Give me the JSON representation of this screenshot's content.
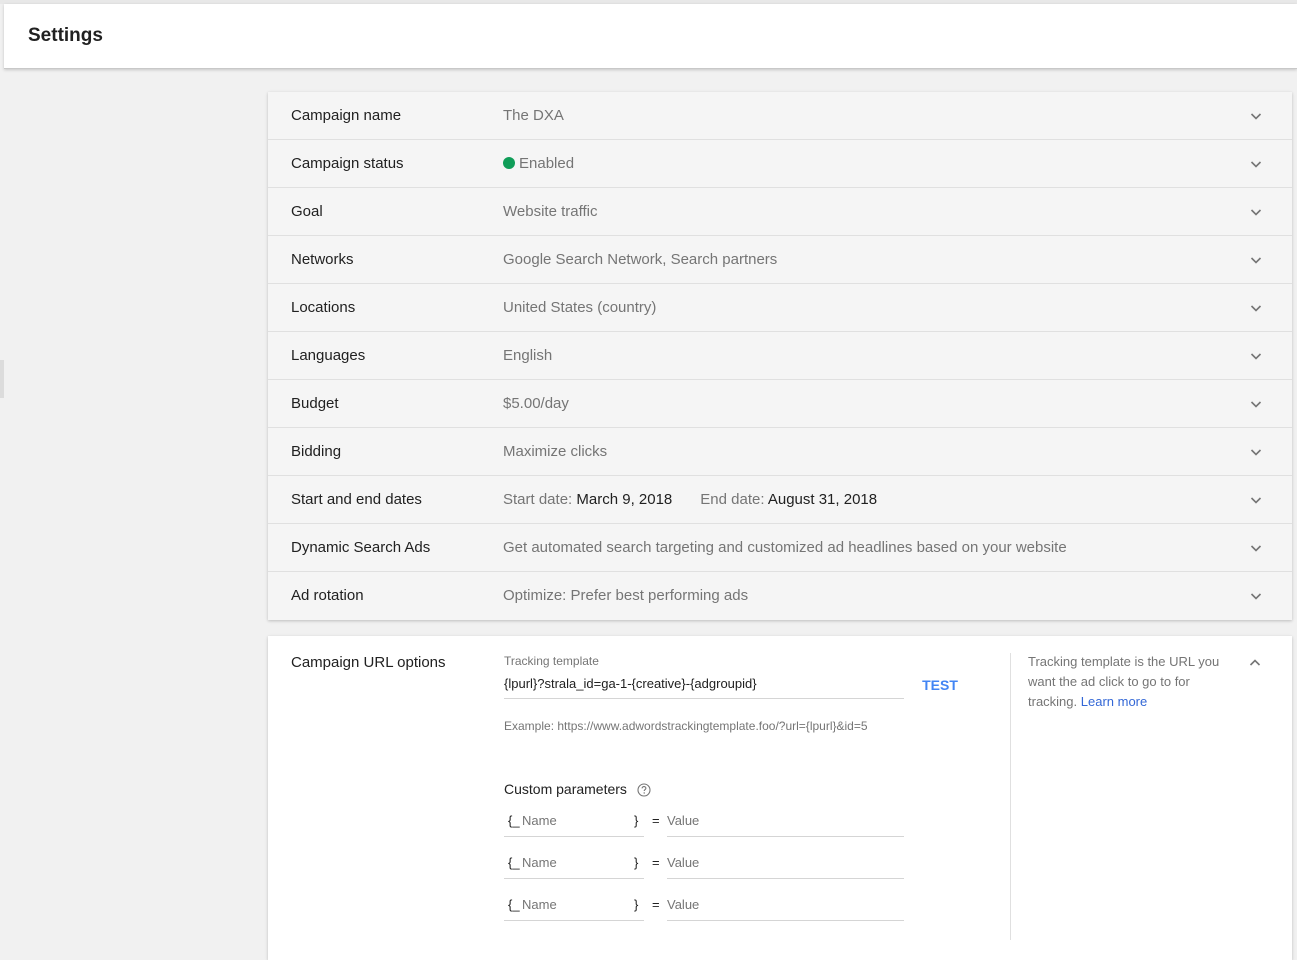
{
  "header": {
    "title": "Settings"
  },
  "settings": [
    {
      "label": "Campaign name",
      "value": "The DXA"
    },
    {
      "label": "Campaign status",
      "value": "Enabled",
      "status_color": "#0f9d58"
    },
    {
      "label": "Goal",
      "value": "Website traffic"
    },
    {
      "label": "Networks",
      "value": "Google Search Network, Search partners"
    },
    {
      "label": "Locations",
      "value": "United States (country)"
    },
    {
      "label": "Languages",
      "value": "English"
    },
    {
      "label": "Budget",
      "value": "$5.00/day"
    },
    {
      "label": "Bidding",
      "value": "Maximize clicks"
    },
    {
      "label": "Start and end dates",
      "start_label": "Start date:",
      "start_value": "March 9, 2018",
      "end_label": "End date:",
      "end_value": "August 31, 2018"
    },
    {
      "label": "Dynamic Search Ads",
      "value": "Get automated search targeting and customized ad headlines based on your website"
    },
    {
      "label": "Ad rotation",
      "value": "Optimize: Prefer best performing ads"
    }
  ],
  "url_options": {
    "label": "Campaign URL options",
    "tracking_caption": "Tracking template",
    "tracking_value": "{lpurl}?strala_id=ga-1-{creative}-{adgroupid}",
    "test_label": "TEST",
    "example": "Example: https://www.adwordstrackingtemplate.foo/?url={lpurl}&id=5",
    "custom_params_title": "Custom parameters",
    "params": [
      {
        "open": "{_",
        "name_placeholder": "Name",
        "close": "}",
        "eq": "=",
        "value_placeholder": "Value"
      },
      {
        "open": "{_",
        "name_placeholder": "Name",
        "close": "}",
        "eq": "=",
        "value_placeholder": "Value"
      },
      {
        "open": "{_",
        "name_placeholder": "Name",
        "close": "}",
        "eq": "=",
        "value_placeholder": "Value"
      }
    ],
    "help_text": "Tracking template is the URL you want the ad click to go to for tracking.",
    "learn_more": "Learn more"
  },
  "icons": {
    "row_toggle": "chevron-down-icon",
    "section_toggle": "chevron-up-icon",
    "help": "help-circle-icon",
    "status": "status-dot-icon"
  },
  "colors": {
    "accent": "#4285f4",
    "link": "#3367d6",
    "status_enabled": "#0f9d58"
  }
}
